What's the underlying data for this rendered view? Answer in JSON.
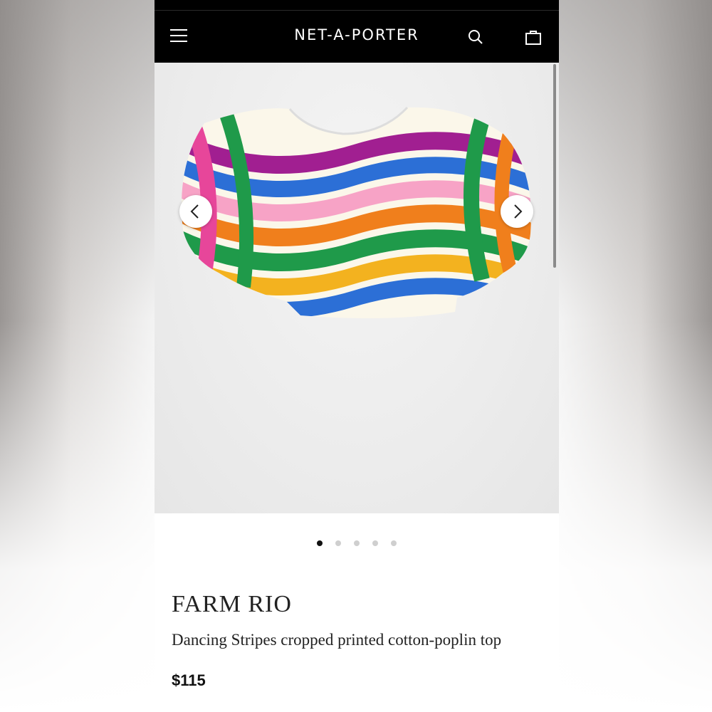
{
  "header": {
    "logo_text": "NET-A-PORTER",
    "menu_icon": "hamburger-menu-icon",
    "search_icon": "search-icon",
    "bag_icon": "shopping-bag-icon"
  },
  "gallery": {
    "image_count": 5,
    "active_index": 0,
    "prev_icon": "chevron-left-icon",
    "next_icon": "chevron-right-icon"
  },
  "product": {
    "brand": "FARM RIO",
    "title": "Dancing Stripes cropped printed cotton-poplin top",
    "price": "$115"
  },
  "colors": {
    "header_bg": "#000000",
    "stripe_colors": [
      "#f07f1c",
      "#1f9a4a",
      "#e7469a",
      "#2c6fd6",
      "#f3b21f",
      "#a11f91",
      "#f7a3c6",
      "#ffffff"
    ]
  }
}
